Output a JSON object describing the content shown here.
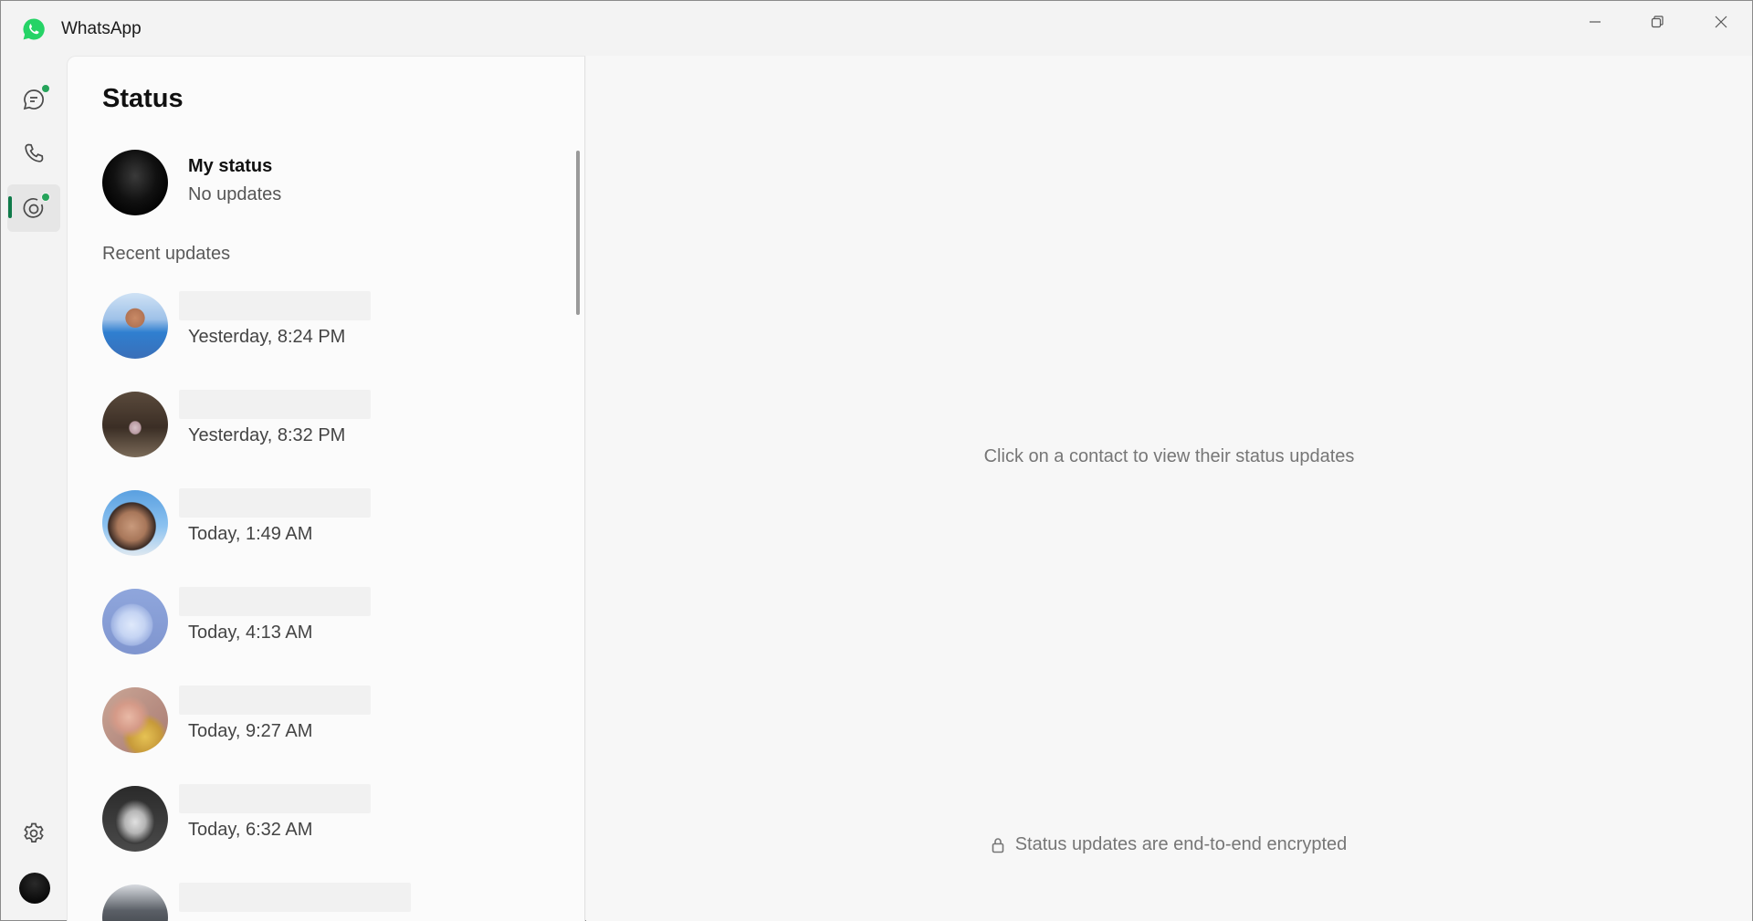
{
  "app": {
    "title": "WhatsApp"
  },
  "window_controls": {
    "minimize_icon": "minimize-icon",
    "maximize_icon": "restore-icon",
    "close_icon": "close-icon"
  },
  "rail": {
    "items": [
      {
        "id": "chats",
        "icon": "chat-icon",
        "badge": true
      },
      {
        "id": "calls",
        "icon": "phone-icon",
        "badge": false
      },
      {
        "id": "status",
        "icon": "status-icon",
        "badge": true,
        "active": true
      }
    ],
    "settings_icon": "gear-icon",
    "accent": "#0f7a4a",
    "badge_color": "#25a35a"
  },
  "status_panel": {
    "title": "Status",
    "my_status": {
      "name": "My status",
      "subtitle": "No updates"
    },
    "recent_label": "Recent updates",
    "updates": [
      {
        "time": "Yesterday, 8:24 PM"
      },
      {
        "time": "Yesterday, 8:32 PM"
      },
      {
        "time": "Today, 1:49 AM"
      },
      {
        "time": "Today, 4:13 AM"
      },
      {
        "time": "Today, 9:27 AM"
      },
      {
        "time": "Today, 6:32 AM"
      },
      {
        "time": ""
      }
    ]
  },
  "main": {
    "hint": "Click on a contact to view their status updates",
    "encrypted_note": "Status updates are end-to-end encrypted"
  }
}
